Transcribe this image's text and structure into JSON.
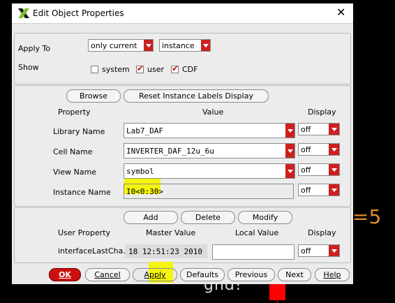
{
  "window": {
    "title": "Edit Object Properties"
  },
  "apply_section": {
    "apply_to_label": "Apply To",
    "apply_scope": "only current",
    "apply_object": "instance",
    "show_label": "Show",
    "show_options": [
      {
        "label": "system",
        "checked": false
      },
      {
        "label": "user",
        "checked": true
      },
      {
        "label": "CDF",
        "checked": true
      }
    ]
  },
  "properties_section": {
    "browse_button": "Browse",
    "reset_button": "Reset Instance Labels Display",
    "headers": {
      "property": "Property",
      "value": "Value",
      "display": "Display"
    },
    "rows": [
      {
        "name": "Library Name",
        "value": "Lab7_DAF",
        "display": "off"
      },
      {
        "name": "Cell Name",
        "value": "INVERTER_DAF_12u_6u",
        "display": "off"
      },
      {
        "name": "View Name",
        "value": "symbol",
        "display": "off"
      },
      {
        "name": "Instance Name",
        "value": "I0<0:30>",
        "display": "off"
      }
    ]
  },
  "user_section": {
    "add_button": "Add",
    "delete_button": "Delete",
    "modify_button": "Modify",
    "headers": {
      "user_property": "User Property",
      "master_value": "Master Value",
      "local_value": "Local Value",
      "display": "Display"
    },
    "row": {
      "name": "interfaceLastCha..",
      "master_value": "18 12:51:23 2010",
      "local_value": "",
      "display": "off"
    }
  },
  "footer": {
    "ok": "OK",
    "cancel": "Cancel",
    "apply": "Apply",
    "defaults": "Defaults",
    "previous": "Previous",
    "next": "Next",
    "help": "Help"
  },
  "background": {
    "equals_text": "=5",
    "gnd_text": "gnd!"
  },
  "colors": {
    "accent_red": "#cc2020",
    "highlight_yellow": "#f4f40e",
    "gnd_red": "#ff0000"
  }
}
